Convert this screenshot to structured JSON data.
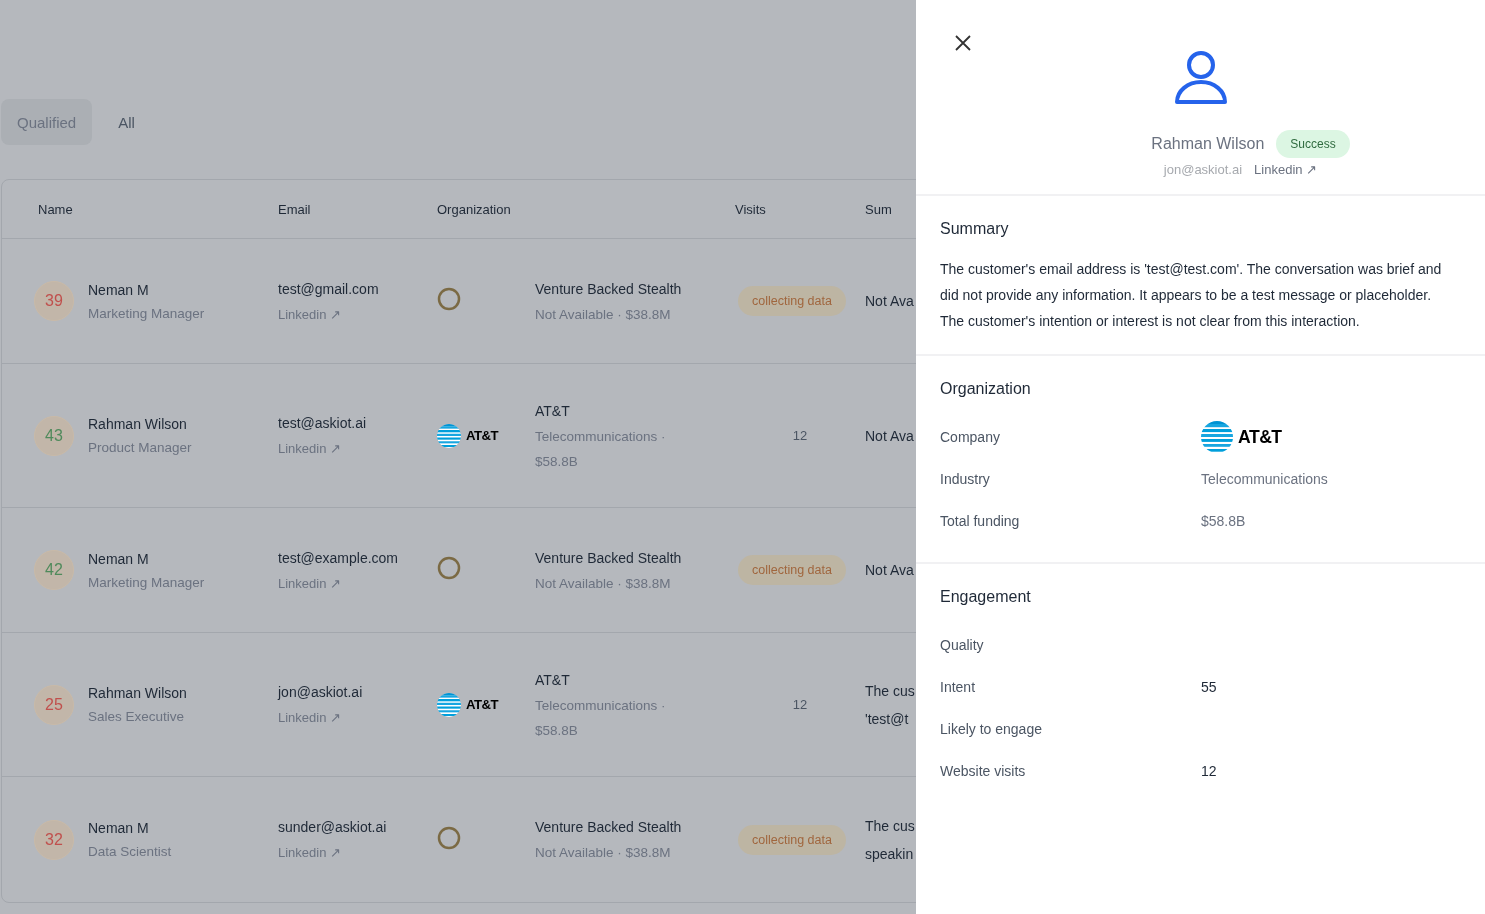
{
  "tabs": [
    {
      "label": "Qualified",
      "selected": true
    },
    {
      "label": "All",
      "selected": false
    }
  ],
  "table": {
    "columns": [
      "Name",
      "Email",
      "Organization",
      "Visits",
      "Sum"
    ],
    "rows": [
      {
        "score": "39",
        "color": "#c0504d",
        "name": "Neman M",
        "title": "Marketing Manager",
        "email": "test@gmail.com",
        "link": "Linkedin ↗",
        "org_logo": {
          "kind": "ring"
        },
        "org_name": "Venture Backed Stealth",
        "org_details": [
          "Not Available · $38.8M"
        ],
        "visits": {
          "kind": "badge",
          "text": "collecting data"
        },
        "summary": [
          "Not Ava"
        ]
      },
      {
        "score": "43",
        "color": "#4f8a5b",
        "name": "Rahman Wilson",
        "title": "Product Manager",
        "email": "test@askiot.ai",
        "link": "Linkedin ↗",
        "org_logo": {
          "kind": "globe",
          "text": "AT&T"
        },
        "org_name": "AT&T",
        "org_details": [
          "Telecommunications ·",
          "$58.8B"
        ],
        "visits": {
          "kind": "number",
          "text": "12"
        },
        "summary": [
          "Not Ava"
        ]
      },
      {
        "score": "42",
        "color": "#4f8a5b",
        "name": "Neman M",
        "title": "Marketing Manager",
        "email": "test@example.com",
        "link": "Linkedin ↗",
        "org_logo": {
          "kind": "ring"
        },
        "org_name": "Venture Backed Stealth",
        "org_details": [
          "Not Available · $38.8M"
        ],
        "visits": {
          "kind": "badge",
          "text": "collecting data"
        },
        "summary": [
          "Not Ava"
        ]
      },
      {
        "score": "25",
        "color": "#c0504d",
        "name": "Rahman Wilson",
        "title": "Sales Executive",
        "email": "jon@askiot.ai",
        "link": "Linkedin ↗",
        "org_logo": {
          "kind": "globe",
          "text": "AT&T"
        },
        "org_name": "AT&T",
        "org_details": [
          "Telecommunications ·",
          "$58.8B"
        ],
        "visits": {
          "kind": "number",
          "text": "12"
        },
        "summary": [
          "The cus",
          "'test@t"
        ]
      },
      {
        "score": "32",
        "color": "#c0504d",
        "name": "Neman M",
        "title": "Data Scientist",
        "email": "sunder@askiot.ai",
        "link": "Linkedin ↗",
        "org_logo": {
          "kind": "ring"
        },
        "org_name": "Venture Backed Stealth",
        "org_details": [
          "Not Available · $38.8M"
        ],
        "visits": {
          "kind": "badge",
          "text": "collecting data"
        },
        "summary": [
          "The cus",
          "speakin"
        ]
      }
    ]
  },
  "panel": {
    "name": "Rahman Wilson",
    "status": "Success",
    "email": "jon@askiot.ai",
    "link": "Linkedin ↗",
    "summary": {
      "heading": "Summary",
      "text": "The customer's email address is 'test@test.com'. The conversation was brief and did not provide any information. It appears to be a test message or placeholder. The customer's intention or interest is not clear from this interaction."
    },
    "organization": {
      "heading": "Organization",
      "rows": [
        {
          "kind": "logo",
          "label": "Company",
          "value": "AT&T"
        },
        {
          "kind": "text",
          "label": "Industry",
          "value": "Telecommunications"
        },
        {
          "kind": "text",
          "label": "Total funding",
          "value": "$58.8B"
        }
      ]
    },
    "engagement": {
      "heading": "Engagement",
      "rows": [
        {
          "label": "Quality"
        },
        {
          "label": "Intent",
          "value": "55"
        },
        {
          "label": "Likely to engage"
        },
        {
          "label": "Website visits",
          "value": "12"
        }
      ]
    }
  }
}
